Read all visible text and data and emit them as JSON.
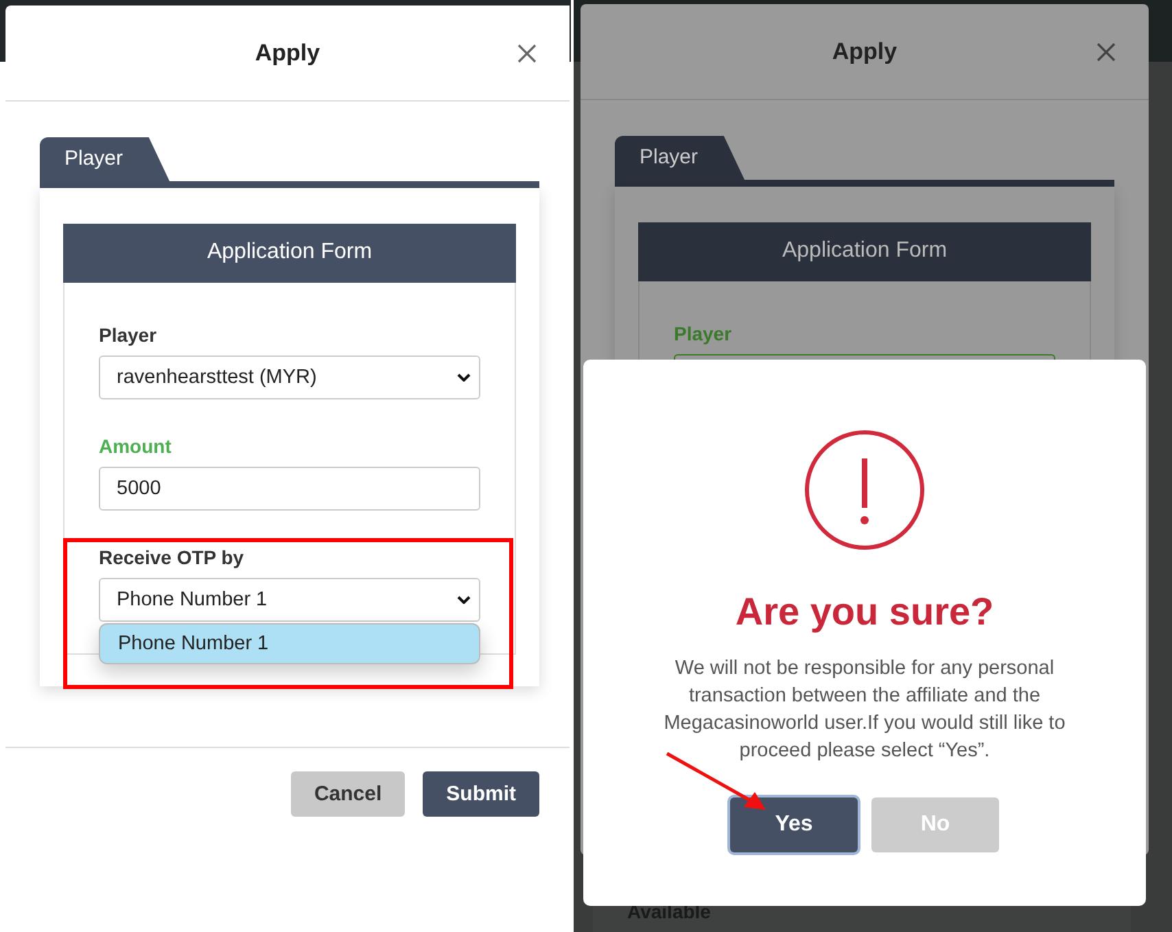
{
  "left_modal": {
    "title": "Apply",
    "tabs": [
      {
        "label": "Player",
        "selected": true
      }
    ],
    "form_title": "Application Form",
    "fields": [
      {
        "label": "Player",
        "value": "ravenhearsttest (MYR)",
        "kind": "select",
        "valid": false
      },
      {
        "label": "Amount",
        "value": "5000",
        "kind": "input",
        "valid": true
      },
      {
        "label": "Receive OTP by",
        "value": "Phone Number 1",
        "kind": "select",
        "valid": false,
        "expanded": true,
        "options": [
          {
            "label": "Phone Number 1",
            "selected": true
          }
        ]
      }
    ],
    "buttons": [
      {
        "label": "Cancel",
        "kind": "secondary"
      },
      {
        "label": "Submit",
        "kind": "primary"
      }
    ]
  },
  "right_modal": {
    "title": "Apply",
    "tabs": [
      {
        "label": "Player",
        "selected": true
      }
    ],
    "form_title": "Application Form",
    "fields": [
      {
        "label": "Player",
        "valid": true
      }
    ]
  },
  "confirm": {
    "title": "Are you sure?",
    "message": "We will not be responsible for any personal transaction between the affiliate and the Megacasinoworld user.If you would still like to proceed please select “Yes”.",
    "buttons": [
      {
        "label": "Yes",
        "kind": "primary",
        "focused": true
      },
      {
        "label": "No",
        "kind": "secondary",
        "focused": false
      }
    ]
  },
  "background_label": "Available"
}
